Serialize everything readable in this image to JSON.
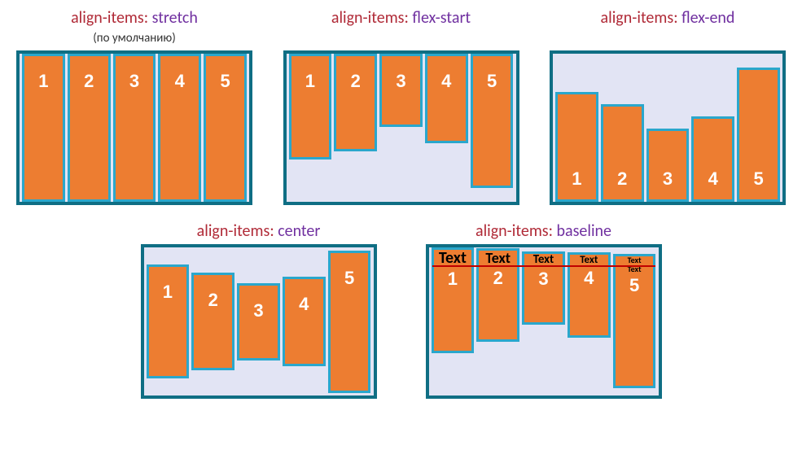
{
  "shared": {
    "property": "align-items",
    "subtitle": "(по умолчанию)"
  },
  "panels": {
    "stretch": {
      "value": "stretch",
      "items": [
        "1",
        "2",
        "3",
        "4",
        "5"
      ]
    },
    "flexStart": {
      "value": "flex-start",
      "items": [
        "1",
        "2",
        "3",
        "4",
        "5"
      ],
      "heights": [
        130,
        120,
        90,
        110,
        165
      ]
    },
    "flexEnd": {
      "value": "flex-end",
      "items": [
        "1",
        "2",
        "3",
        "4",
        "5"
      ],
      "heights": [
        135,
        120,
        90,
        105,
        165
      ]
    },
    "center": {
      "value": "center",
      "items": [
        "1",
        "2",
        "3",
        "4",
        "5"
      ],
      "heights": [
        140,
        120,
        95,
        110,
        175
      ]
    },
    "baseline": {
      "value": "baseline",
      "items": [
        "1",
        "2",
        "3",
        "4",
        "5"
      ],
      "heights": [
        130,
        115,
        90,
        105,
        165
      ],
      "text": "Text",
      "fontSizes": [
        20,
        18,
        15,
        13,
        10
      ],
      "extraBottomTextOn": 5
    }
  }
}
